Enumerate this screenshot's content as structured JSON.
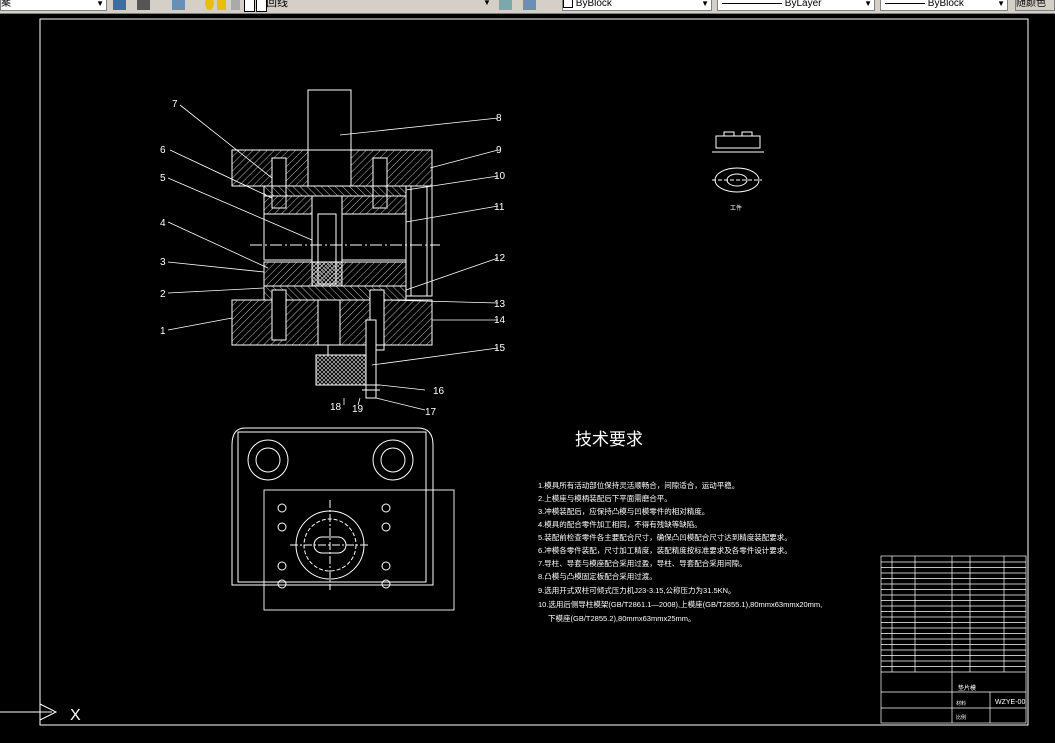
{
  "toolbar": {
    "left_combo_tail": "案",
    "layer_text": "回线",
    "color_value": "ByBlock",
    "linetype_value": "ByLayer",
    "lineweight_value": "ByBlock",
    "right_button_label": "随颜色"
  },
  "drawing": {
    "title_heading": "技术要求",
    "requirements": [
      "1.模具所有活动部位保持灵活顺畅合，间隙适合，运动平稳。",
      "2.上模座与模柄装配后下平面需磨合平。",
      "3.冲模装配后，应保持凸模与凹模零件的相对精度。",
      "4.模具的配合零件加工相同，不得有残缺等缺陷。",
      "5.装配前检查零件各主要配合尺寸，确保凸凹模配合尺寸达到精度装配要求。",
      "6.冲模各零件装配，尺寸加工精度，装配精度按标准要求及各零件设计要求。",
      "7.导柱、导套与模座配合采用过盈，导柱、导套配合采用间隙。",
      "8.凸模与凸模固定板配合采用过渡。",
      "9.选用开式双柱可倾式压力机J23-3.15,公称压力为31.5KN。",
      "10.选用后侧导柱模架(GB/T2861.1—2008),上模座(GB/T2855.1),80mmx63mmx20mm,",
      "下模座(GB/T2855.2),80mmx63mmx25mm。"
    ],
    "part_callouts": [
      "1",
      "2",
      "3",
      "4",
      "5",
      "6",
      "7",
      "8",
      "9",
      "10",
      "11",
      "12",
      "13",
      "14",
      "15",
      "16",
      "17",
      "18",
      "19"
    ],
    "part_caption": "工件",
    "title_block": {
      "drawing_name": "垫片模",
      "drawing_no": "WZYE-00",
      "material_label": "材料",
      "scale_label": "比例"
    },
    "ucs_label": "X"
  }
}
